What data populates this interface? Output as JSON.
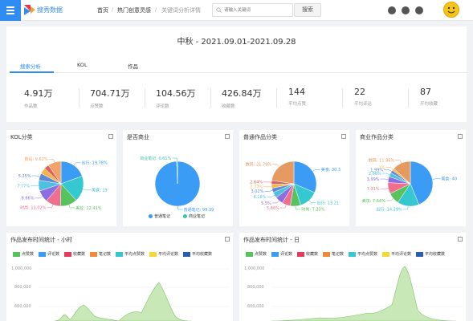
{
  "topbar": {
    "brand": "搜秀数据",
    "crumbs": [
      "首页",
      "热门创意灵感",
      "关键词分析详情"
    ],
    "search_placeholder": "请输入关键词",
    "search_button": "搜索"
  },
  "page_title": "中秋  -  2021.09.01-2021.09.28",
  "tabs": [
    "搜索分析",
    "KOL",
    "作品"
  ],
  "kpis": [
    {
      "value": "4.91万",
      "label": "作品数"
    },
    {
      "value": "704.71万",
      "label": "点赞数"
    },
    {
      "value": "104.56万",
      "label": "评论数"
    },
    {
      "value": "426.84万",
      "label": "收藏数"
    },
    {
      "value": "144",
      "label": "平均点赞"
    },
    {
      "value": "22",
      "label": "平均评论"
    },
    {
      "value": "87",
      "label": "平均收藏"
    }
  ],
  "chart_data": [
    {
      "type": "pie",
      "title": "KOL分类",
      "slices": [
        {
          "label": "出行",
          "value": 19.78,
          "text": "出行: 19.78%",
          "color": "#3a9cf5"
        },
        {
          "label": "美食",
          "value": 19.0,
          "text": "美食: 19",
          "color": "#36c8d0"
        },
        {
          "label": "美妆",
          "value": 12.41,
          "text": "美妆: 12.41%",
          "color": "#58c35c"
        },
        {
          "label": "时尚",
          "value": 11.02,
          "text": "时尚: 11.02%",
          "color": "#f06f8e"
        },
        {
          "label": "",
          "value": 8.66,
          "text": "8.66%",
          "color": "#8d6ee0"
        },
        {
          "label": "",
          "value": 7.77,
          "text": "7.77%",
          "color": "#4cc0e0"
        },
        {
          "label": "",
          "value": 5.25,
          "text": "5.25%",
          "color": "#5d8ad8"
        },
        {
          "label": "",
          "value": 4.5,
          "text": "",
          "color": "#f5b54a"
        },
        {
          "label": "",
          "value": 3.5,
          "text": "",
          "color": "#e06060"
        },
        {
          "label": "数码",
          "value": 9.62,
          "text": "数码: 9.62%",
          "color": "#f0a46a"
        }
      ]
    },
    {
      "type": "pie",
      "title": "是否商业",
      "slices": [
        {
          "label": "普通笔记",
          "value": 99.39,
          "text": "普通笔记: 99.39",
          "color": "#3a9cf5"
        },
        {
          "label": "商业笔记",
          "value": 0.61,
          "text": "商业笔记: 0.61%",
          "color": "#36c8a0"
        }
      ],
      "legend": [
        "普通笔记",
        "商业笔记"
      ]
    },
    {
      "type": "pie",
      "title": "普通作品分类",
      "slices": [
        {
          "label": "美食",
          "value": 30.3,
          "text": "美食: 30.3",
          "color": "#3a9cf5"
        },
        {
          "label": "出行",
          "value": 13.21,
          "text": "出行: 13.21",
          "color": "#36c8d0"
        },
        {
          "label": "时尚",
          "value": 7.23,
          "text": "时尚: 7.23%",
          "color": "#58c35c"
        },
        {
          "label": "",
          "value": 5.86,
          "text": "5.86%",
          "color": "#f06f8e"
        },
        {
          "label": "",
          "value": 5.5,
          "text": "5.5%",
          "color": "#8d6ee0"
        },
        {
          "label": "",
          "value": 4.16,
          "text": "4.16%",
          "color": "#4cc0e0"
        },
        {
          "label": "",
          "value": 3.02,
          "text": "3.02%",
          "color": "#5d8ad8"
        },
        {
          "label": "",
          "value": 2.77,
          "text": "2.77%",
          "color": "#f5b54a"
        },
        {
          "label": "",
          "value": 2.64,
          "text": "2.64%",
          "color": "#e06060"
        },
        {
          "label": "数码",
          "value": 21.79,
          "text": "数码: 21.79%",
          "color": "#e59a62"
        }
      ]
    },
    {
      "type": "pie",
      "title": "商业作品分类",
      "slices": [
        {
          "label": "美食",
          "value": 40.0,
          "text": "美食: 40",
          "color": "#3a9cf5"
        },
        {
          "label": "出行",
          "value": 14.29,
          "text": "出行: 14.29%",
          "color": "#36c8d0"
        },
        {
          "label": "美妆",
          "value": 7.64,
          "text": "美妆: 7.64%",
          "color": "#58c35c"
        },
        {
          "label": "",
          "value": 7.31,
          "text": "7.31%",
          "color": "#f06f8e"
        },
        {
          "label": "",
          "value": 3.99,
          "text": "3.99%",
          "color": "#8d6ee0"
        },
        {
          "label": "",
          "value": 2.66,
          "text": "2.66%",
          "color": "#4cc0e0"
        },
        {
          "label": "",
          "value": 1.99,
          "text": "1.99%",
          "color": "#5d8ad8"
        },
        {
          "label": "",
          "value": 1.5,
          "text": "1%",
          "color": "#f5b54a"
        },
        {
          "label": "数码",
          "value": 11.96,
          "text": "数码: 11.96%",
          "color": "#e59a62"
        }
      ]
    },
    {
      "type": "area",
      "title": "作品发布时间统计 - 小时",
      "legend": [
        "点赞数",
        "评论数",
        "收藏数",
        "笔记数",
        "平均点赞数",
        "平均评论数",
        "平均收藏数"
      ],
      "yticks": [
        "1,000,000",
        "800,000",
        "600,000"
      ],
      "ylim": [
        0,
        1000000
      ]
    },
    {
      "type": "area",
      "title": "作品发布时间统计 - 日",
      "legend": [
        "点赞数",
        "评论数",
        "收藏数",
        "笔记数",
        "平均点赞数",
        "平均评论数",
        "平均收藏数"
      ],
      "yticks": [
        "1,000,000",
        "800,000",
        "600,000"
      ],
      "ylim": [
        0,
        1000000
      ]
    }
  ],
  "legend_colors": [
    "#58c35c",
    "#3a9cf5",
    "#e83a5a",
    "#f08a3a",
    "#36c8d0",
    "#f5d73a",
    "#2a5fb0"
  ]
}
